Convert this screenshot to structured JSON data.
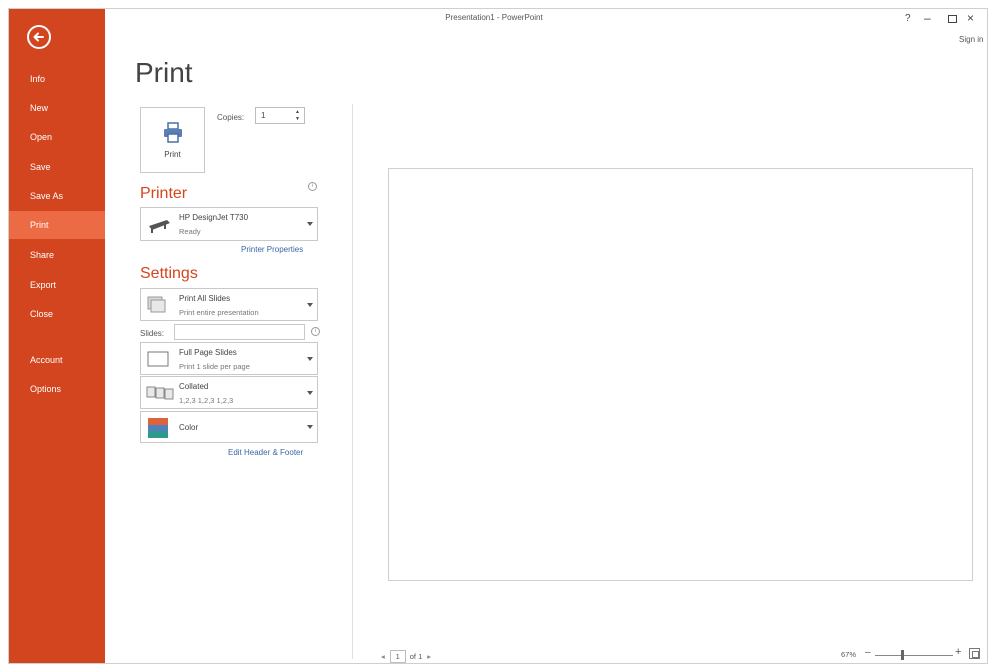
{
  "window": {
    "title": "Presentation1 - PowerPoint",
    "help": "?",
    "minimize": "–",
    "close": "×",
    "sign_in": "Sign in"
  },
  "sidebar": {
    "items": [
      {
        "label": "Info"
      },
      {
        "label": "New"
      },
      {
        "label": "Open"
      },
      {
        "label": "Save"
      },
      {
        "label": "Save As"
      },
      {
        "label": "Print",
        "active": true
      },
      {
        "label": "Share"
      },
      {
        "label": "Export"
      },
      {
        "label": "Close"
      },
      {
        "label": "Account"
      },
      {
        "label": "Options"
      }
    ],
    "accent_color": "#d2451f",
    "active_color": "#ec6b44"
  },
  "print": {
    "title": "Print",
    "button_label": "Print",
    "copies_label": "Copies:",
    "copies_value": "1"
  },
  "printer": {
    "heading": "Printer",
    "name": "HP DesignJet T730",
    "status": "Ready",
    "properties_link": "Printer Properties"
  },
  "settings": {
    "heading": "Settings",
    "range_title": "Print All Slides",
    "range_sub": "Print entire presentation",
    "slides_label": "Slides:",
    "slides_value": "",
    "layout_title": "Full Page Slides",
    "layout_sub": "Print 1 slide per page",
    "collate_title": "Collated",
    "collate_sub": "1,2,3   1,2,3   1,2,3",
    "color_title": "Color",
    "header_footer_link": "Edit Header & Footer"
  },
  "preview": {
    "page_prefix": "◂",
    "page_number": "1",
    "page_of": "of 1",
    "page_next": "▸",
    "zoom": "67%",
    "zoom_level": 0.35
  }
}
